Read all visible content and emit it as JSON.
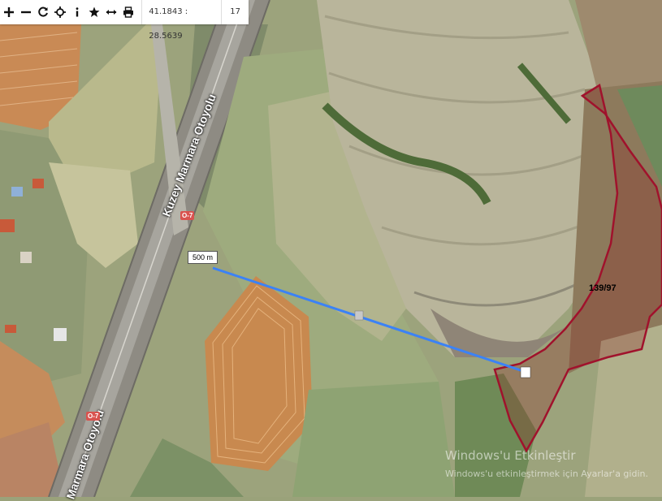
{
  "toolbar": {
    "buttons": [
      {
        "name": "zoom-in",
        "glyph": "+"
      },
      {
        "name": "zoom-out",
        "glyph": "−"
      },
      {
        "name": "refresh",
        "glyph": "⟳"
      },
      {
        "name": "locate",
        "glyph": "⌖"
      },
      {
        "name": "info",
        "glyph": "i"
      },
      {
        "name": "favorite",
        "glyph": "★"
      },
      {
        "name": "measure",
        "glyph": "↔"
      },
      {
        "name": "print",
        "glyph": "⎙"
      }
    ],
    "coordinates": "41.1843 : 28.5639",
    "zoom_level": "17"
  },
  "map": {
    "road_name_upper": "Kuzey Marmara Otoyolu",
    "road_name_lower": "Marmara Otoyolu",
    "road_shield": "O-7",
    "measurement_label": "500 m",
    "parcel_label": "139/97",
    "colors": {
      "parcel_outline": "#a0122c",
      "measure_line": "#3b82f6"
    }
  },
  "watermark": {
    "title": "Windows'u Etkinleştir",
    "subtitle": "Windows'u etkinleştirmek için Ayarlar'a gidin."
  }
}
